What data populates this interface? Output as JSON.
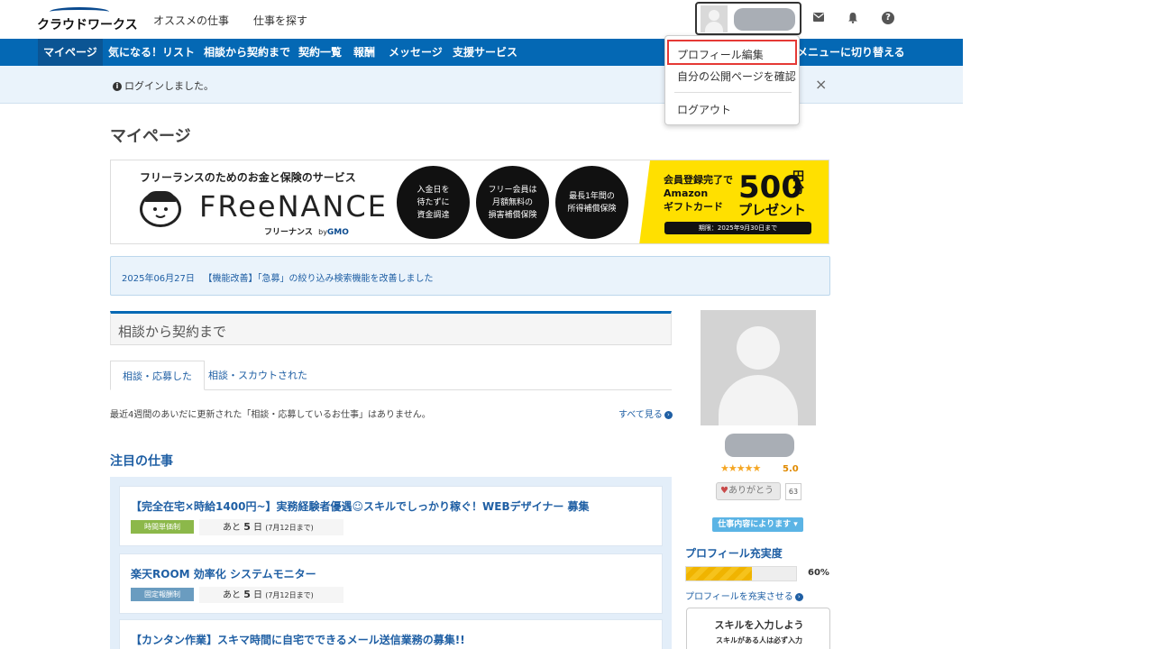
{
  "header": {
    "logo_text": "クラウドワークス",
    "links": [
      "オススメの仕事",
      "仕事を探す"
    ],
    "icons": [
      "mail-icon",
      "bell-icon",
      "help-icon"
    ],
    "help_glyph": "?"
  },
  "nav": {
    "items": [
      "マイページ",
      "気になる！リスト",
      "相談から契約まで",
      "契約一覧",
      "報酬",
      "メッセージ",
      "支援サービス"
    ],
    "switch_menu": "メニューに切り替える"
  },
  "notice": {
    "icon": "i",
    "text": "ログインしました。",
    "close": "×"
  },
  "dropdown": {
    "items": [
      "プロフィール編集",
      "自分の公開ページを確認",
      "ログアウト"
    ]
  },
  "page_title": "マイページ",
  "banner": {
    "headline": "フリーランスのためのお金と保険のサービス",
    "brand": "FReeNANCE",
    "brand_sub": "フリーナンス",
    "brand_by": "by",
    "brand_gmo": "GMO",
    "circles": [
      "入金日を\n待たずに\n資金調達",
      "フリー会員は\n月額無料の\n損害補償保険",
      "最長1年間の\n所得補償保険"
    ],
    "promo_left": "会員登録完了で\nAmazon\nギフトカード",
    "promo_amount": "500",
    "promo_unit": "円\n分",
    "promo_present": "プレゼント",
    "promo_deadline": "期限：2025年9月30日まで"
  },
  "announcement": {
    "date": "2025年06月27日",
    "text": "【機能改善】「急募」の絞り込み検索機能を改善しました"
  },
  "consult": {
    "title": "相談から契約まで",
    "tabs": [
      "相談・応募した",
      "相談・スカウトされた"
    ],
    "empty": "最近4週間のあいだに更新された「相談・応募しているお仕事」はありません。",
    "see_all": "すべて見る"
  },
  "featured": {
    "title": "注目の仕事",
    "jobs": [
      {
        "title": "【完全在宅×時給1400円~】実務経験者優遇☺スキルでしっかり稼ぐ！WEBデザイナー 募集",
        "badge": "時間単価制",
        "deadline_prefix": "あと",
        "days": "5",
        "unit": "日",
        "until": "(7月12日まで)"
      },
      {
        "title": "楽天ROOM 効率化 システムモニター",
        "badge": "固定報酬制",
        "deadline_prefix": "あと",
        "days": "5",
        "unit": "日",
        "until": "(7月12日まで)"
      },
      {
        "title": "【カンタン作業】スキマ時間に自宅でできるメール送信業務の募集!!"
      }
    ],
    "badge_colors": [
      "#8cb84a",
      "#6a9cc0"
    ]
  },
  "sidebar": {
    "stars": "★★★★★",
    "rating": "5.0",
    "thanks_label": "ありがとう",
    "thanks_count": "63",
    "rate_badge": "仕事内容によります",
    "profile_title": "プロフィール充実度",
    "profile_progress": 0.6,
    "profile_percent": "60%",
    "profile_link": "プロフィールを充実させる",
    "skill_title": "スキルを入力しよう",
    "skill_sub": "スキルがある人は必ず入力"
  },
  "colors": {
    "brand_blue": "#0468b4",
    "link_blue": "#1f5fa4",
    "highlight_red": "#e53935",
    "promo_yellow": "#ffe000"
  }
}
